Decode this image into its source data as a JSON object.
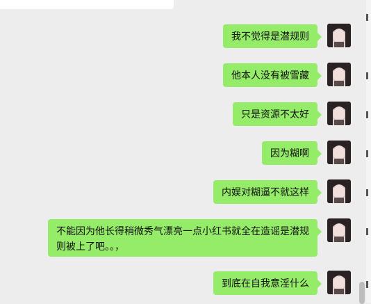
{
  "messages": [
    {
      "text": "我不觉得是潜规则"
    },
    {
      "text": "他本人没有被雪藏"
    },
    {
      "text": "只是资源不太好"
    },
    {
      "text": "因为糊啊"
    },
    {
      "text": "内娱对糊逼不就这样"
    },
    {
      "text": "不能因为他长得稍微秀气漂亮一点小红书就全在造谣是潜规则被上了吧。。，"
    },
    {
      "text": "到底在自我意淫什么"
    }
  ],
  "colors": {
    "bubble": "#95ec69",
    "background": "#ededed"
  }
}
